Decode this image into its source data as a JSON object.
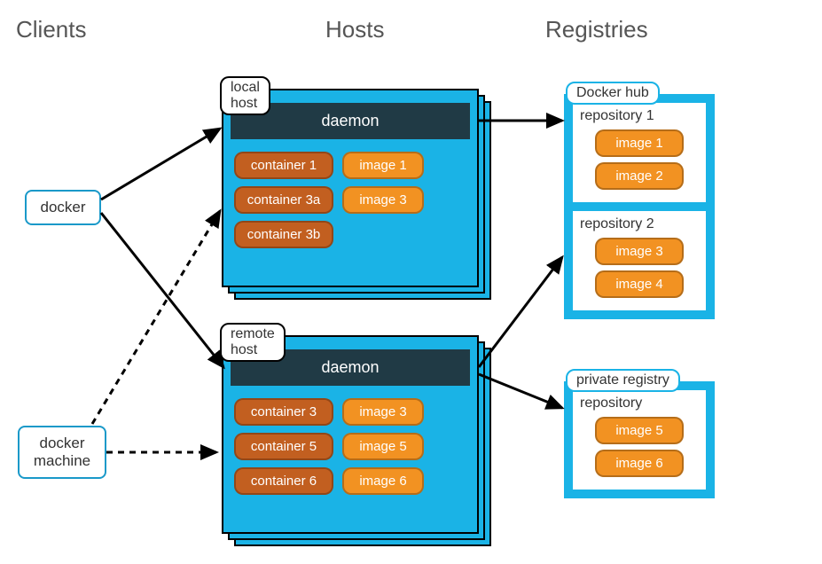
{
  "headings": {
    "clients": "Clients",
    "hosts": "Hosts",
    "registries": "Registries"
  },
  "clients": {
    "docker": "docker",
    "docker_machine": "docker\nmachine"
  },
  "hosts": {
    "local": {
      "label": "local host",
      "daemon": "daemon",
      "rows": {
        "r1_c": "container 1",
        "r1_i": "image 1",
        "r2_c": "container 3a",
        "r2_i": "image 3",
        "r3_c": "container 3b"
      }
    },
    "remote": {
      "label": "remote host",
      "daemon": "daemon",
      "rows": {
        "r1_c": "container 3",
        "r1_i": "image 3",
        "r2_c": "container 5",
        "r2_i": "image 5",
        "r3_c": "container 6",
        "r3_i": "image 6"
      }
    }
  },
  "registries": {
    "hub": {
      "label": "Docker hub",
      "repo1": {
        "title": "repository 1",
        "img1": "image 1",
        "img2": "image 2"
      },
      "repo2": {
        "title": "repository 2",
        "img1": "image 3",
        "img2": "image 4"
      }
    },
    "private": {
      "label": "private registry",
      "repo": {
        "title": "repository",
        "img1": "image 5",
        "img2": "image 6"
      }
    }
  }
}
